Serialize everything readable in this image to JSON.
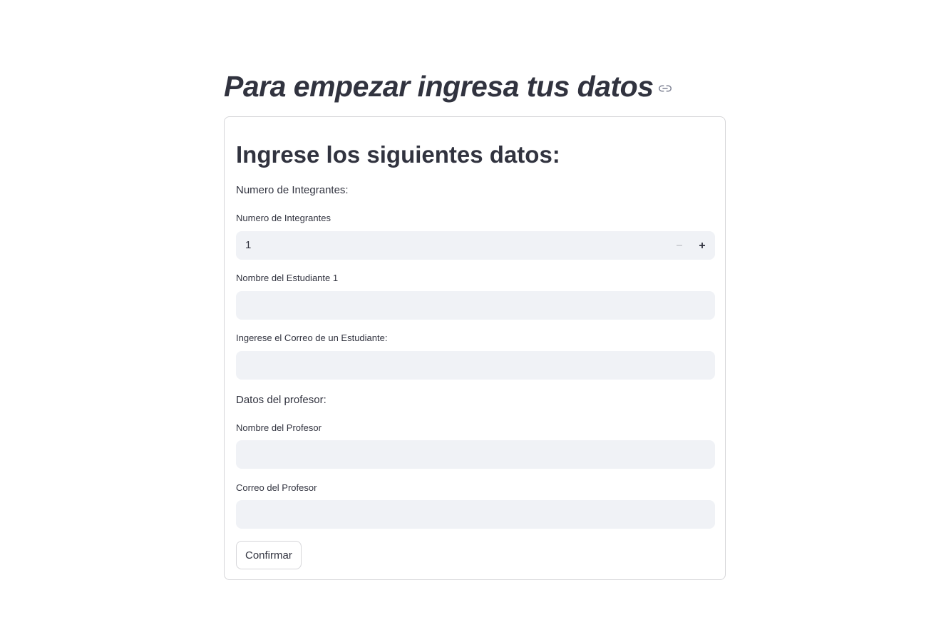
{
  "page": {
    "title": "Para empezar ingresa tus datos"
  },
  "form": {
    "heading": "Ingrese los siguientes datos:",
    "section_students": "Numero de Integrantes:",
    "members": {
      "label": "Numero de Integrantes",
      "value": "1"
    },
    "student_name": {
      "label": "Nombre del Estudiante 1",
      "value": ""
    },
    "student_email": {
      "label": "Ingerese el Correo de un Estudiante:",
      "value": ""
    },
    "section_professor": "Datos del profesor:",
    "professor_name": {
      "label": "Nombre del Profesor",
      "value": ""
    },
    "professor_email": {
      "label": "Correo del Profesor",
      "value": ""
    },
    "submit_label": "Confirmar"
  },
  "icons": {
    "anchor": "link-icon",
    "decrement": "minus-icon",
    "increment": "plus-icon"
  },
  "colors": {
    "text": "#31333f",
    "input_bg": "#f0f2f6",
    "border": "#d6d6d9",
    "minus_disabled": "#c4c6cc"
  }
}
